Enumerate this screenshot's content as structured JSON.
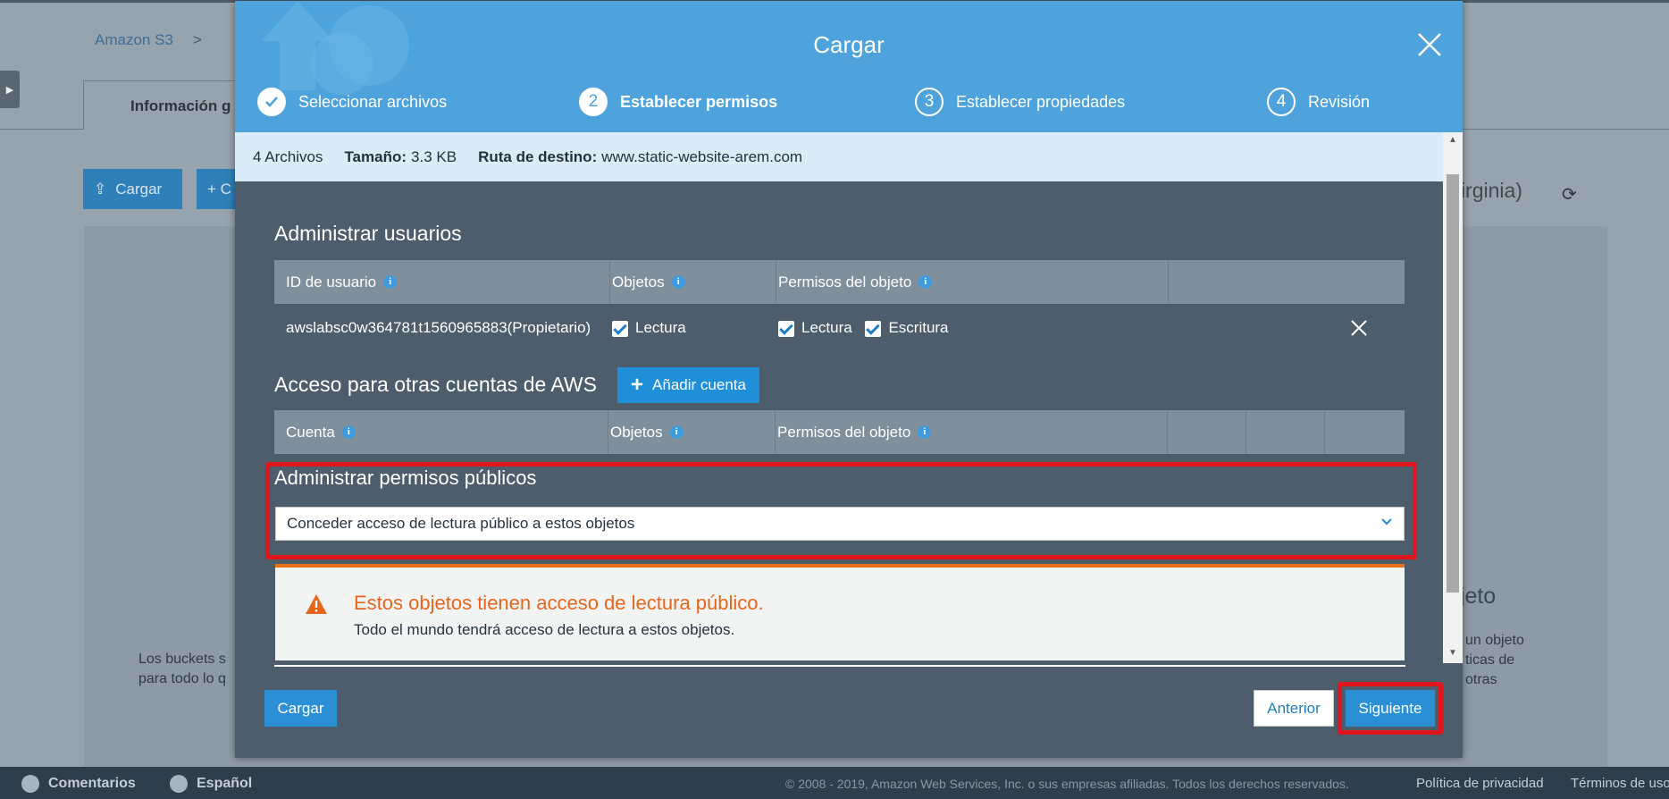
{
  "background": {
    "breadcrumb": {
      "root": "Amazon S3",
      "separator": ">"
    },
    "side_toggle": "▶",
    "tab_label": "Información g",
    "upload_button": "Cargar",
    "create_button": "+ C",
    "region_text": "Virginia)",
    "left_text_line1": "Los buckets s",
    "left_text_line2": "para todo lo q",
    "right_title": "bjeto",
    "right_text_line1": "un objeto",
    "right_text_line2": "ticas de",
    "right_text_line3": "otras"
  },
  "modal": {
    "title": "Cargar",
    "steps": [
      {
        "number": "✓",
        "label": "Seleccionar archivos",
        "state": "completed"
      },
      {
        "number": "2",
        "label": "Establecer permisos",
        "state": "current"
      },
      {
        "number": "3",
        "label": "Establecer propiedades",
        "state": "pending"
      },
      {
        "number": "4",
        "label": "Revisión",
        "state": "pending"
      }
    ],
    "info_bar": {
      "files": "4 Archivos",
      "size_label": "Tamaño:",
      "size_value": "3.3 KB",
      "dest_label": "Ruta de destino:",
      "dest_value": "www.static-website-arem.com"
    },
    "manage_users": {
      "title": "Administrar usuarios",
      "headers": [
        "ID de usuario",
        "Objetos",
        "Permisos del objeto"
      ],
      "row": {
        "user_id": "awslabsc0w364781t1560965883(Propietario)",
        "objects_read": "Lectura",
        "perm_read": "Lectura",
        "perm_write": "Escritura"
      }
    },
    "other_accounts": {
      "title": "Acceso para otras cuentas de AWS",
      "add_button": "Añadir cuenta",
      "headers": [
        "Cuenta",
        "Objetos",
        "Permisos del objeto"
      ]
    },
    "public_permissions": {
      "title": "Administrar permisos públicos",
      "selected": "Conceder acceso de lectura público a estos objetos"
    },
    "alert": {
      "title": "Estos objetos tienen acceso de lectura público.",
      "text": "Todo el mundo tendrá acceso de lectura a estos objetos."
    },
    "buttons": {
      "upload": "Cargar",
      "previous": "Anterior",
      "next": "Siguiente"
    }
  },
  "footer": {
    "feedback": "Comentarios",
    "language": "Español",
    "copyright": "© 2008 - 2019, Amazon Web Services, Inc. o sus empresas afiliadas. Todos los derechos reservados.",
    "privacy": "Política de privacidad",
    "terms": "Términos de uso"
  },
  "colors": {
    "header_blue": "#4fa3dc",
    "modal_body": "#4d5d6b",
    "highlight_red": "#e0151d",
    "alert_orange": "#e8661b",
    "button_blue": "#2b8fd6"
  }
}
